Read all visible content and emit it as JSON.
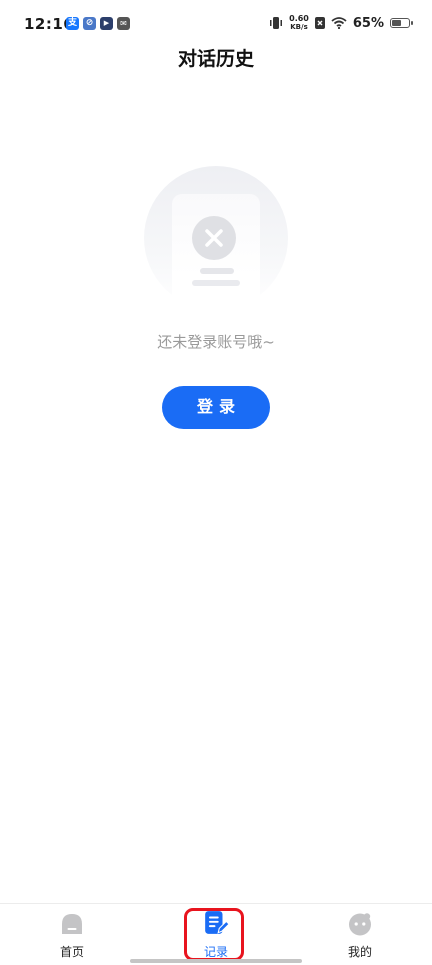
{
  "status_bar": {
    "time": "12:16",
    "app_icons": [
      {
        "name": "alipay-icon",
        "glyph": "支",
        "color": "#1677ff"
      },
      {
        "name": "app-icon",
        "glyph": "⊘",
        "color": "#4a78c8"
      },
      {
        "name": "play-icon",
        "glyph": "▶",
        "color": "#2c3e6b"
      },
      {
        "name": "mail-icon",
        "glyph": "✉",
        "color": "#555555"
      }
    ],
    "net_speed_value": "0.60",
    "net_speed_unit": "KB/s",
    "battery_percent": "65%",
    "battery_level": 0.65
  },
  "header": {
    "title": "对话历史"
  },
  "empty_state": {
    "message": "还未登录账号哦~",
    "button_label": "登录"
  },
  "bottom_nav": {
    "items": [
      {
        "label": "首页",
        "icon": "home-icon",
        "active": false
      },
      {
        "label": "记录",
        "icon": "record-icon",
        "active": true
      },
      {
        "label": "我的",
        "icon": "profile-icon",
        "active": false
      }
    ]
  },
  "colors": {
    "accent": "#1a6cf5",
    "highlight": "#e8141e",
    "muted_text": "#9a9a9a"
  }
}
